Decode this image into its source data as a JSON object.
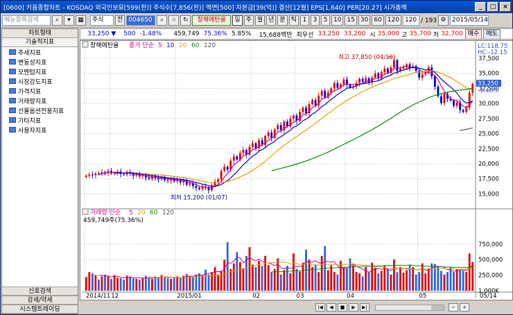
{
  "title": "[0600] 키움종합차트 - KOSDAQ 외국인보유[599(천)] 주식수[7,856(천)] 액면[500] 자본금[39(억)] 결산[12월] EPS[1,640] PER[20.27] 시가총액",
  "toolbar": {
    "search_placeholder": "메뉴항목검색",
    "type_select": "주식",
    "code_label": "전",
    "code_value": "004650",
    "stock_name": "창해에탄올",
    "periods": [
      "주",
      "월",
      "년",
      "분",
      "틱"
    ],
    "active_period": "일",
    "intervals": [
      "1",
      "3",
      "5",
      "10",
      "15",
      "30",
      "60",
      "120"
    ],
    "count_value": "120",
    "count_total": "/ 193",
    "date_value": "2015/05/14"
  },
  "sidebar": {
    "top_tab": "차트형태",
    "section": "기술적지표",
    "items": [
      "추세지표",
      "변동성지표",
      "모멘텀지표",
      "시장강도지표",
      "가격지표",
      "거래량지표",
      "선물옵션전용지표",
      "기타지표",
      "사용자지표"
    ],
    "footer": [
      "신호검색",
      "강세/약세",
      "시스템트레이딩"
    ]
  },
  "info": {
    "price": "33,250 ▼",
    "change": "500",
    "change_pct": "-1.48%",
    "volume": "459,749",
    "vol_ratio": "75.36%",
    "turnover": "5.85%",
    "amount": "15,688백만",
    "best_ask_label": "최우선",
    "best_ask": "33,250",
    "best_bid": "33,200",
    "open_label": "시",
    "open": "35,000",
    "high_label": "고",
    "high": "35,700",
    "low_label": "저",
    "low": "32,700",
    "buy_btn": "매수",
    "sell_btn": "매도"
  },
  "chart_data": [
    {
      "type": "candlestick",
      "title": "창해에탄올",
      "legend": "종가 단순",
      "ma_periods": [
        "5",
        "10",
        "20",
        "60",
        "120"
      ],
      "ma_colors": [
        "#d00090",
        "#0000c0",
        "#e0a000",
        "#009000",
        "#505050"
      ],
      "x_ticks": [
        "2014/11",
        "12",
        "2015/01",
        "02",
        "03",
        "04",
        "05",
        "05/14"
      ],
      "y_ticks": [
        "37,500",
        "35,000",
        "32,500",
        "30,000",
        "27,500",
        "25,000",
        "22,500",
        "20,000",
        "17,500",
        "15,000"
      ],
      "ylim": [
        13200,
        39000
      ],
      "annot_high": "최고 37,850 (04/10)",
      "annot_low": "최저 15,200 (01/07)",
      "lc": "LC:118.75",
      "hc": "HC:-12.15",
      "last_price": "33,250",
      "last_pct": "-1.48%",
      "up_color": "#e00000",
      "down_color": "#0000e0",
      "closes": [
        18000,
        18200,
        18100,
        18400,
        18300,
        18600,
        18500,
        18800,
        18400,
        18500,
        18700,
        18300,
        18200,
        18600,
        18400,
        18000,
        18200,
        17900,
        18100,
        17700,
        17500,
        17900,
        17600,
        17400,
        17800,
        17300,
        17200,
        17600,
        17100,
        17300,
        16900,
        17200,
        16500,
        16800,
        16300,
        16000,
        15800,
        16200,
        16100,
        15600,
        16400,
        17000,
        17400,
        18800,
        19500,
        19000,
        20500,
        21200,
        20700,
        21800,
        22300,
        21500,
        22800,
        23400,
        22600,
        23900,
        23100,
        24600,
        25200,
        24300,
        25700,
        26400,
        25600,
        27000,
        26200,
        27500,
        28000,
        27100,
        28600,
        29300,
        28400,
        29900,
        30600,
        29700,
        31300,
        32100,
        31000,
        31800,
        32500,
        33400,
        32600,
        33200,
        34000,
        33100,
        32700,
        32800,
        33400,
        34100,
        33600,
        34200,
        33500,
        34300,
        35000,
        34200,
        35200,
        35800,
        35100,
        36000,
        37200,
        35400,
        35800,
        36000,
        36500,
        35900,
        36200,
        35400,
        34300,
        34800,
        35200,
        36000,
        34500,
        32800,
        31200,
        30100,
        31600,
        30800,
        30500,
        29600,
        30200,
        28900,
        28600,
        29300,
        31800,
        33250
      ],
      "volume_ticks": [
        "1,000K",
        "750,000",
        "500,000",
        "250,000"
      ],
      "volume_ylim": [
        0,
        1250000
      ],
      "volume_label": "거래량 단순",
      "volume_ma_periods": [
        "5",
        "20",
        "60",
        "120"
      ],
      "volume_readout": "459,749주(75.36%)",
      "volumes": [
        220,
        300,
        280,
        250,
        180,
        230,
        260,
        240,
        190,
        250,
        210,
        200,
        180,
        240,
        230,
        200,
        190,
        180,
        210,
        240,
        200,
        190,
        230,
        210,
        250,
        220,
        200,
        190,
        210,
        230,
        200,
        240,
        270,
        230,
        220,
        260,
        280,
        250,
        340,
        260,
        300,
        380,
        260,
        320,
        500,
        780,
        350,
        440,
        620,
        460,
        360,
        560,
        700,
        420,
        380,
        480,
        400,
        560,
        410,
        300,
        350,
        520,
        260,
        330,
        400,
        280,
        600,
        350,
        310,
        450,
        660,
        500,
        380,
        420,
        300,
        560,
        720,
        330,
        410,
        300,
        260,
        480,
        380,
        360,
        520,
        410,
        300,
        280,
        230,
        380,
        300,
        450,
        370,
        280,
        320,
        400,
        350,
        260,
        500,
        300,
        380,
        290,
        330,
        420,
        380,
        260,
        300,
        440,
        280,
        360,
        440,
        430,
        400,
        320,
        260,
        300,
        380,
        300,
        350,
        330,
        320,
        300,
        600,
        460
      ],
      "volume_up_color": "#e00000",
      "volume_down_color": "#3060e0"
    }
  ]
}
